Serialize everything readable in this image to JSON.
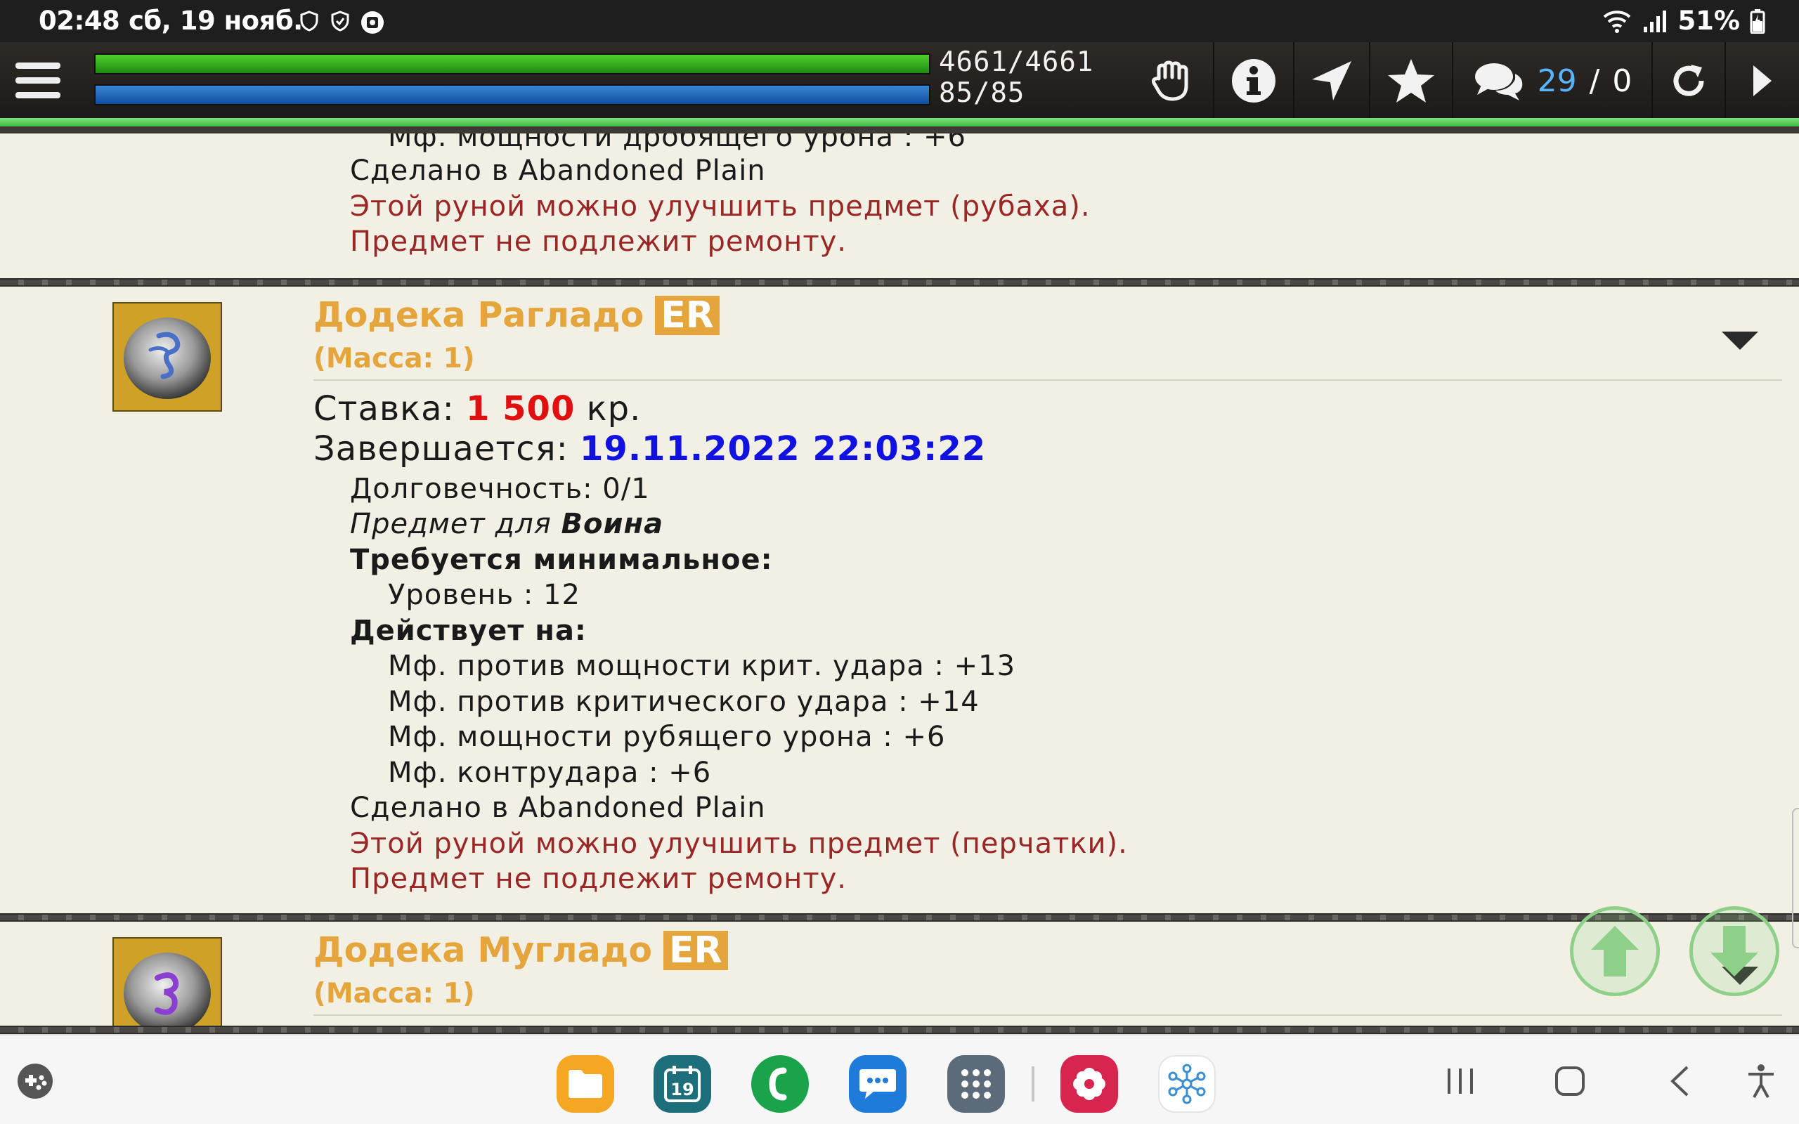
{
  "statusbar": {
    "time": "02:48",
    "date": "сб, 19 нояб.",
    "battery": "51%"
  },
  "toolbar": {
    "hp_text": "4661/4661",
    "mp_text": "85/85",
    "hp_fraction": 1.0,
    "mp_fraction": 1.0,
    "messages_count": "29",
    "messages_sep": "/",
    "messages_other": "0",
    "icons": [
      "menu-icon",
      "hand-icon",
      "info-icon",
      "navigate-icon",
      "star-icon",
      "chat-icon",
      "refresh-icon",
      "play-icon"
    ]
  },
  "prev_item": {
    "cut_line": "Мф. мощности дробящего урона : +6",
    "made_in": "Сделано в Abandoned Plain",
    "rune_note": "Этой руной можно улучшить предмет (рубаха).",
    "repair_note": "Предмет не подлежит ремонту."
  },
  "item1": {
    "name": "Додека Рагладо",
    "badge": "ER",
    "mass": "(Масса: 1)",
    "bid_label": "Ставка:",
    "bid_value": "1 500",
    "bid_currency": "кр.",
    "ends_label": "Завершается:",
    "ends_value": "19.11.2022 22:03:22",
    "durability": "Долговечность: 0/1",
    "class_prefix": "Предмет для",
    "class_name": "Воина",
    "req_header": "Требуется минимальное:",
    "req_level": "Уровень : 12",
    "effects_header": "Действует на:",
    "effects": [
      "Мф. против мощности крит. удара : +13",
      "Мф. против критического удара : +14",
      "Мф. мощности рубящего урона : +6",
      "Мф. контрудара : +6"
    ],
    "made_in": "Сделано в Abandoned Plain",
    "rune_note": "Этой руной можно улучшить предмет (перчатки).",
    "repair_note": "Предмет не подлежит ремонту.",
    "rune_color": "#4a6fc7"
  },
  "item2": {
    "name": "Додека Мугладо",
    "badge": "ER",
    "mass": "(Масса: 1)",
    "rune_color": "#8a3fd0"
  },
  "colors": {
    "accent_gold": "#e3a53c",
    "bid_red": "#e01010",
    "date_blue": "#1111e0",
    "note_red": "#9a2626",
    "hp_green": "#3cb81e",
    "mp_blue": "#1e62b8"
  },
  "taskbar": {
    "calendar_day": "19",
    "apps": [
      "files-app-icon",
      "calendar-app-icon",
      "phone-app-icon",
      "messages-app-icon",
      "app-drawer-icon",
      "flower-app-icon",
      "network-app-icon"
    ]
  }
}
